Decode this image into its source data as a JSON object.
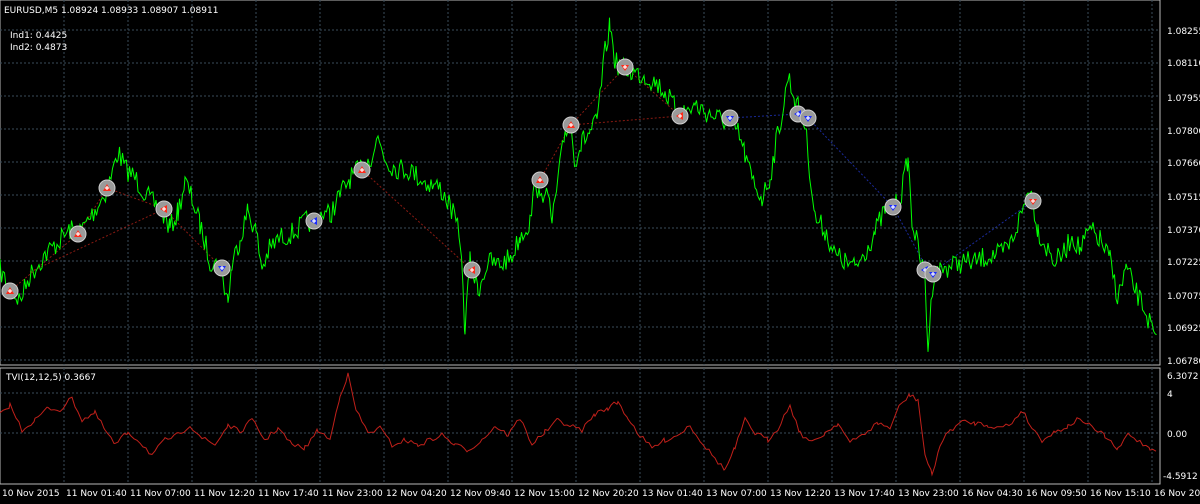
{
  "header": {
    "symbol_line": "EURUSD,M5  1.08924 1.08933 1.08907 1.08911",
    "ind1": "Ind1: 0.4425",
    "ind2": "Ind2: 0.4873"
  },
  "price_axis": {
    "ticks": [
      "1.08255",
      "1.08110",
      "1.07955",
      "1.07800",
      "1.07660",
      "1.07515",
      "1.07370",
      "1.07225",
      "1.07075",
      "1.06925",
      "1.06780"
    ],
    "range": [
      1.0678,
      1.0833
    ]
  },
  "indicator_panel": {
    "title": "TVI(12,12,5) 0.3667",
    "ticks": [
      "6.3072",
      "4",
      "0.00",
      "-4.5912"
    ],
    "range": [
      -4.5912,
      6.3072
    ]
  },
  "time_axis": {
    "labels": [
      "10 Nov 2015",
      "11 Nov 01:40",
      "11 Nov 07:00",
      "11 Nov 12:20",
      "11 Nov 17:40",
      "11 Nov 23:00",
      "12 Nov 04:20",
      "12 Nov 09:40",
      "12 Nov 15:00",
      "12 Nov 20:20",
      "13 Nov 01:40",
      "13 Nov 07:00",
      "13 Nov 12:20",
      "13 Nov 17:40",
      "13 Nov 23:00",
      "16 Nov 04:30",
      "16 Nov 09:50",
      "16 Nov 15:10",
      "16 Nov 20:"
    ]
  },
  "colors": {
    "background": "#000000",
    "price_line": "#00ff00",
    "indicator_line": "#c0201a",
    "grid": "#3a4b5a",
    "axis_text": "#ffffff",
    "buy_arrow": "#ff2a1a",
    "sell_arrow": "#1a2aff"
  },
  "signal_icons": [
    {
      "price": 1.0709,
      "kind": "sell",
      "direction": "up"
    },
    {
      "price": 1.0735,
      "kind": "sell",
      "direction": "up"
    },
    {
      "price": 1.0754,
      "kind": "sell",
      "direction": "up"
    },
    {
      "price": 1.0746,
      "kind": "sell",
      "direction": "left"
    },
    {
      "price": 1.0721,
      "kind": "buy",
      "direction": "down"
    },
    {
      "price": 1.0741,
      "kind": "buy",
      "direction": "left"
    },
    {
      "price": 1.0756,
      "kind": "sell",
      "direction": "up"
    },
    {
      "price": 1.0718,
      "kind": "sell",
      "direction": "left"
    },
    {
      "price": 1.0764,
      "kind": "sell",
      "direction": "up"
    },
    {
      "price": 1.0783,
      "kind": "sell",
      "direction": "up"
    },
    {
      "price": 1.081,
      "kind": "sell",
      "direction": "down"
    },
    {
      "price": 1.0787,
      "kind": "sell",
      "direction": "left"
    },
    {
      "price": 1.0786,
      "kind": "buy",
      "direction": "down"
    },
    {
      "price": 1.0787,
      "kind": "buy",
      "direction": "left"
    },
    {
      "price": 1.0786,
      "kind": "buy",
      "direction": "down"
    },
    {
      "price": 1.0748,
      "kind": "buy",
      "direction": "down"
    },
    {
      "price": 1.072,
      "kind": "buy",
      "direction": "left"
    },
    {
      "price": 1.0719,
      "kind": "buy",
      "direction": "down"
    },
    {
      "price": 1.075,
      "kind": "sell",
      "direction": "down"
    }
  ]
}
